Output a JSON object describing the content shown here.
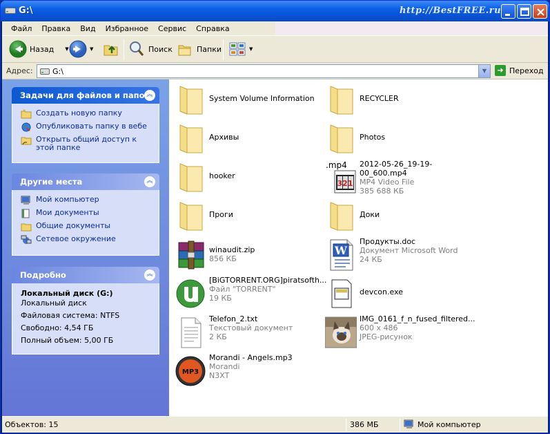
{
  "window": {
    "title": "G:\\",
    "brand": "http://BestFREE.ru"
  },
  "menu": [
    "Файл",
    "Правка",
    "Вид",
    "Избранное",
    "Сервис",
    "Справка"
  ],
  "toolbar": {
    "back_label": "Назад",
    "search_label": "Поиск",
    "folders_label": "Папки"
  },
  "address": {
    "label": "Адрес:",
    "value": "G:\\",
    "go_label": "Переход"
  },
  "left": {
    "tasks": {
      "title": "Задачи для файлов и папок",
      "items": [
        "Создать новую папку",
        "Опубликовать папку в вебе",
        "Открыть общий доступ к этой папке"
      ]
    },
    "places": {
      "title": "Другие места",
      "items": [
        "Мой компьютер",
        "Мои документы",
        "Общие документы",
        "Сетевое окружение"
      ]
    },
    "details": {
      "title": "Подробно",
      "name": "Локальный диск (G:)",
      "type": "Локальный диск",
      "fs": "Файловая система: NTFS",
      "free": "Свободно: 4,54 ГБ",
      "total": "Полный объем: 5,00 ГБ"
    }
  },
  "files": [
    {
      "name": "System Volume Information",
      "line2": "",
      "line3": "",
      "icon": "folder-icon"
    },
    {
      "name": "RECYCLER",
      "line2": "",
      "line3": "",
      "icon": "folder-icon"
    },
    {
      "name": "Архивы",
      "line2": "",
      "line3": "",
      "icon": "folder-icon"
    },
    {
      "name": "Photos",
      "line2": "",
      "line3": "",
      "icon": "folder-icon"
    },
    {
      "name": "hooker",
      "line2": "",
      "line3": "",
      "icon": "folder-icon"
    },
    {
      "name": "2012-05-26_19-19-00_600.mp4",
      "line2": "MP4 Video File",
      "line3": "385 688 КБ",
      "icon": "mp4-icon",
      "badge": ".mp4",
      "badge2": "321"
    },
    {
      "name": "Проги",
      "line2": "",
      "line3": "",
      "icon": "folder-icon"
    },
    {
      "name": "Доки",
      "line2": "",
      "line3": "",
      "icon": "folder-icon"
    },
    {
      "name": "winaudit.zip",
      "line2": "856 КБ",
      "line3": "",
      "icon": "winrar-icon"
    },
    {
      "name": "Продукты.doc",
      "line2": "Документ Microsoft Word",
      "line3": "24 КБ",
      "icon": "word-icon",
      "badge": "W"
    },
    {
      "name": "[BiGTORRENT.ORG]piratsofth...",
      "line2": "Файл \"TORRENT\"",
      "line3": "19 КБ",
      "icon": "utorrent-icon"
    },
    {
      "name": "devcon.exe",
      "line2": "",
      "line3": "",
      "icon": "exe-icon"
    },
    {
      "name": "Telefon_2.txt",
      "line2": "Текстовый документ",
      "line3": "2 КБ",
      "icon": "txt-icon"
    },
    {
      "name": "IMG_0161_f_n_fused_filtered...",
      "line2": "600 x 486",
      "line3": "JPEG-рисунок",
      "icon": "photo-icon"
    },
    {
      "name": "Morandi - Angels.mp3",
      "line2": "Morandi",
      "line3": "N3XT",
      "icon": "mp3-icon",
      "badge": "MP3"
    }
  ],
  "status": {
    "objects": "Объектов: 15",
    "size": "386 МБ",
    "location": "Мой компьютер"
  }
}
